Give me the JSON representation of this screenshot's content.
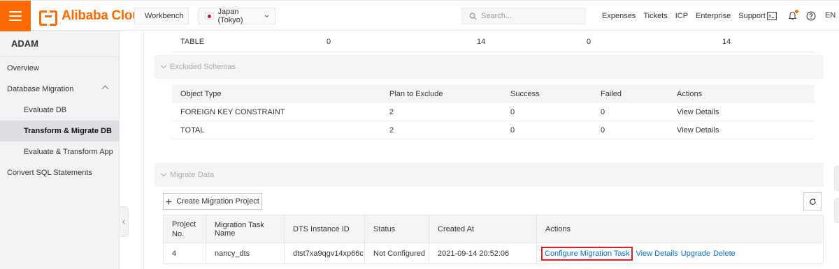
{
  "topbar": {
    "brand": "Alibaba Cloud",
    "workbench": "Workbench",
    "region": "Japan (Tokyo)",
    "search_placeholder": "Search...",
    "links": [
      "Expenses",
      "Tickets",
      "ICP",
      "Enterprise",
      "Support"
    ],
    "lang": "EN",
    "accent": "#ff6a00"
  },
  "sidebar": {
    "title": "ADAM",
    "items": [
      {
        "label": "Overview"
      },
      {
        "label": "Database Migration"
      },
      {
        "label": "Evaluate DB"
      },
      {
        "label": "Transform & Migrate DB"
      },
      {
        "label": "Evaluate & Transform App"
      },
      {
        "label": "Convert SQL Statements"
      }
    ]
  },
  "summary_row": {
    "cells": [
      "TABLE",
      "0",
      "14",
      "0",
      "14"
    ]
  },
  "excluded": {
    "title": "Excluded Schemas",
    "headers": [
      "Object Type",
      "Plan to Exclude",
      "Success",
      "Failed",
      "Actions"
    ],
    "rows": [
      [
        "FOREIGN KEY CONSTRAINT",
        "2",
        "0",
        "0",
        "View Details"
      ],
      [
        "TOTAL",
        "2",
        "0",
        "0",
        "View Details"
      ]
    ]
  },
  "migrate": {
    "title": "Migrate Data",
    "create_label": "Create Migration Project",
    "headers": [
      "Project No.",
      "Migration Task Name",
      "DTS Instance ID",
      "Status",
      "Created At",
      "Actions"
    ],
    "row": {
      "no": "4",
      "name": "nancy_dts",
      "dts_id": "dtst7xa9qgv14xp66c",
      "status": "Not Configured",
      "created": "2021-09-14 20:52:06",
      "actions": [
        "Configure Migration Task",
        "View Details",
        "Upgrade",
        "Delete"
      ]
    },
    "highlight_color": "#e02020"
  }
}
